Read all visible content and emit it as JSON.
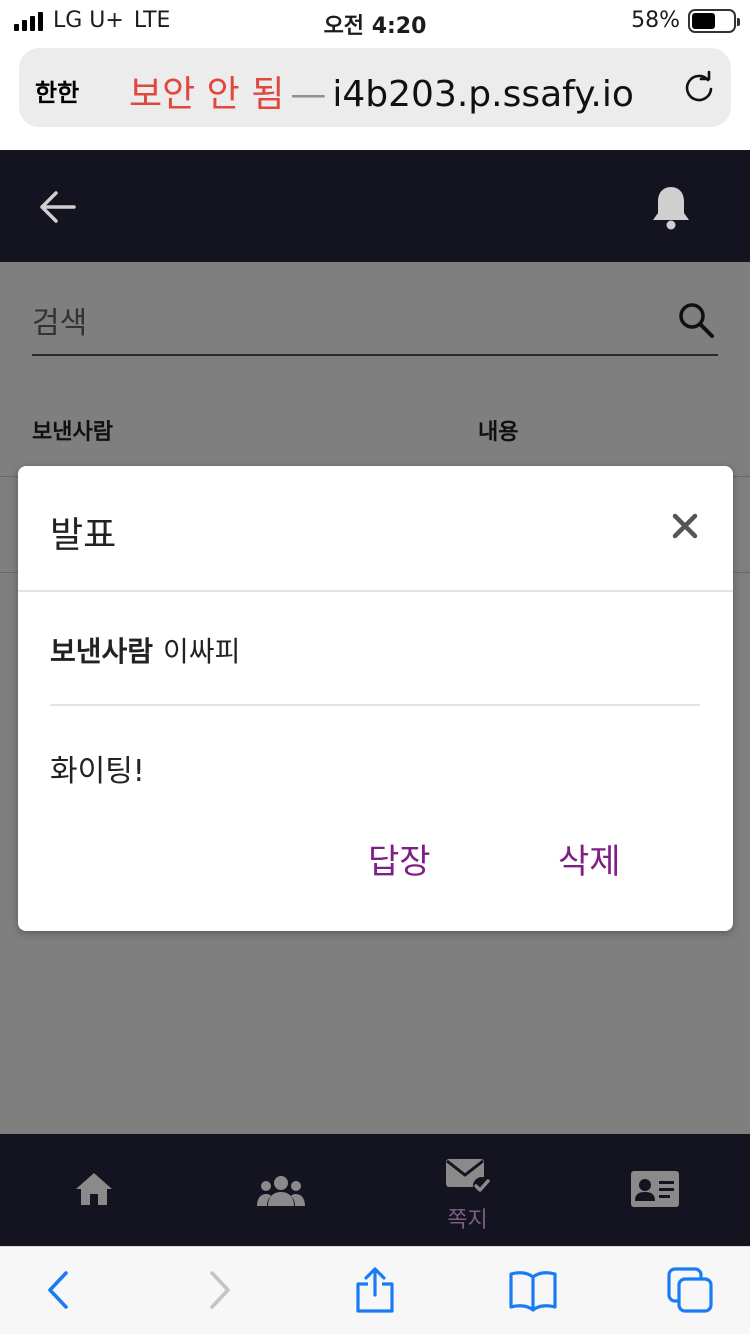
{
  "status_bar": {
    "carrier": "LG U+",
    "network": "LTE",
    "time": "오전 4:20",
    "battery_percent": "58%",
    "battery_level": 0.58
  },
  "browser": {
    "aa_label": "한한",
    "security_warning": "보안 안 됨",
    "separator": "—",
    "host": "i4b203.p.ssafy.io"
  },
  "page": {
    "search": {
      "placeholder": "검색",
      "value": ""
    },
    "columns": {
      "sender": "보낸사람",
      "content": "내용"
    }
  },
  "modal": {
    "title": "발표",
    "sender_label": "보낸사람",
    "sender_name": "이싸피",
    "message": "화이팅!",
    "reply_label": "답장",
    "delete_label": "삭제"
  },
  "bottom_nav": {
    "messages_label": "쪽지"
  },
  "colors": {
    "header_bg": "#13141f",
    "accent_purple": "#7d1f86",
    "warning_red": "#e0473e",
    "safari_blue": "#1a7cf5"
  }
}
